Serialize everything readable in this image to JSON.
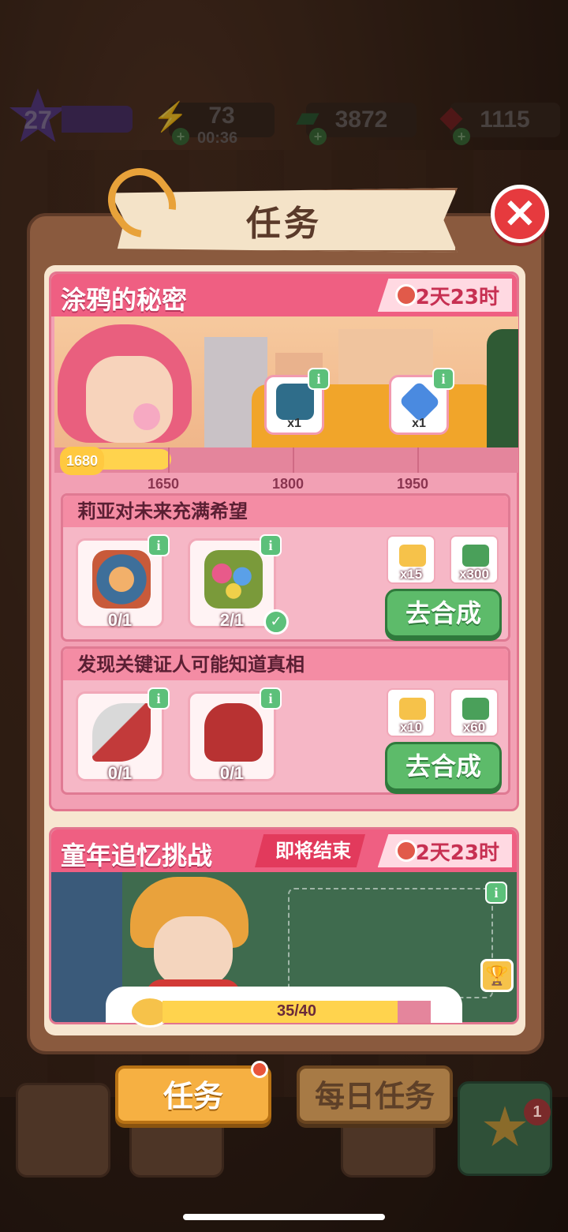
{
  "topbar": {
    "level": "27",
    "energy": "73",
    "energy_timer": "00:36",
    "cash": "3872",
    "gems": "1115"
  },
  "panel": {
    "title": "任务",
    "close_icon": "close-icon"
  },
  "event1": {
    "title": "涂鸦的秘密",
    "timer": "2天23时",
    "progress_value": "1680",
    "milestones": [
      "1650",
      "1800",
      "1950"
    ],
    "progress_fraction": 0.2,
    "rewards": [
      {
        "icon": "treasure-chest-icon",
        "qty": "x1"
      },
      {
        "icon": "hourglass-gem-icon",
        "qty": "x1"
      }
    ],
    "tasks": [
      {
        "title": "莉亚对未来充满希望",
        "items": [
          {
            "icon": "vase-icon",
            "count": "0/1",
            "done": false
          },
          {
            "icon": "flower-basket-icon",
            "count": "2/1",
            "done": true
          }
        ],
        "rewards": [
          {
            "icon": "star-coin-icon",
            "qty": "x15"
          },
          {
            "icon": "cash-icon",
            "qty": "x300"
          }
        ],
        "button": "去合成"
      },
      {
        "title": "发现关键证人可能知道真相",
        "items": [
          {
            "icon": "pruning-shears-icon",
            "count": "0/1",
            "done": false
          },
          {
            "icon": "red-gloves-icon",
            "count": "0/1",
            "done": false
          }
        ],
        "rewards": [
          {
            "icon": "star-coin-icon",
            "qty": "x10"
          },
          {
            "icon": "cash-icon",
            "qty": "x60"
          }
        ],
        "button": "去合成"
      }
    ]
  },
  "event2": {
    "title": "童年追忆挑战",
    "ending_label": "即将结束",
    "timer": "2天23时",
    "progress_text": "35/40",
    "progress_fraction": 0.875
  },
  "bottom": {
    "tab_tasks": "任务",
    "tab_daily": "每日任务",
    "star_badge": "1"
  },
  "colors": {
    "accent_pink": "#ef5f82",
    "go_green": "#5dbb6a",
    "tab_orange": "#f6b042"
  }
}
